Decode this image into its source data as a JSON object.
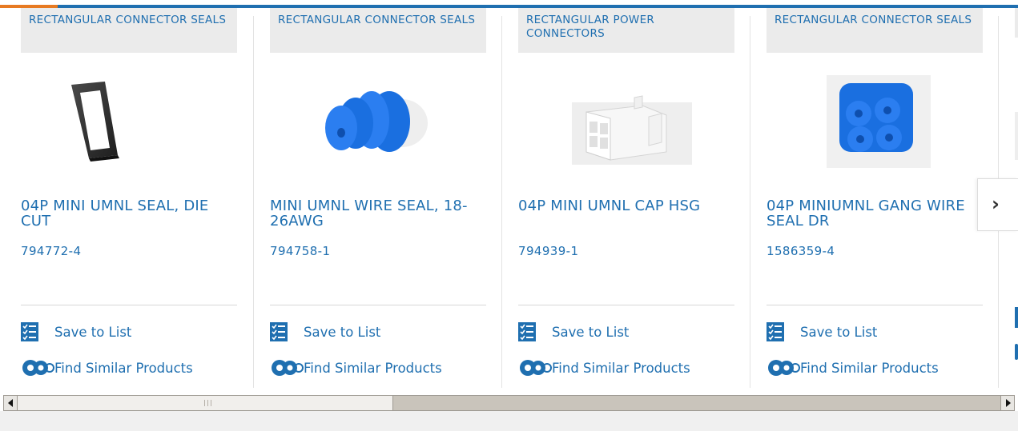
{
  "colors": {
    "link": "#1f6fb0",
    "accent": "#e77a22",
    "category_bg": "#ebebeb"
  },
  "cards": [
    {
      "category": "RECTANGULAR CONNECTOR SEALS",
      "title": "04P MINI UMNL SEAL, DIE CUT",
      "part_number": "794772-4",
      "image": "black-rectangular-die-cut-seal",
      "save_label": "Save to List",
      "find_label": "Find Similar Products"
    },
    {
      "category": "RECTANGULAR CONNECTOR SEALS",
      "title": "MINI UMNL WIRE SEAL, 18-26AWG",
      "part_number": "794758-1",
      "image": "blue-ribbed-wire-seal",
      "save_label": "Save to List",
      "find_label": "Find Similar Products"
    },
    {
      "category": "RECTANGULAR POWER CONNECTORS",
      "title": "04P MINI UMNL CAP HSG",
      "part_number": "794939-1",
      "image": "white-4-position-cap-housing",
      "save_label": "Save to List",
      "find_label": "Find Similar Products"
    },
    {
      "category": "RECTANGULAR CONNECTOR SEALS",
      "title": "04P MINIUMNL GANG WIRE SEAL DR",
      "part_number": "1586359-4",
      "image": "blue-4-way-gang-wire-seal",
      "save_label": "Save to List",
      "find_label": "Find Similar Products"
    }
  ],
  "icons": {
    "save": "checklist-icon",
    "find": "gears-icon",
    "next": "chevron-right-icon"
  },
  "carousel": {
    "next_glyph": "›"
  }
}
